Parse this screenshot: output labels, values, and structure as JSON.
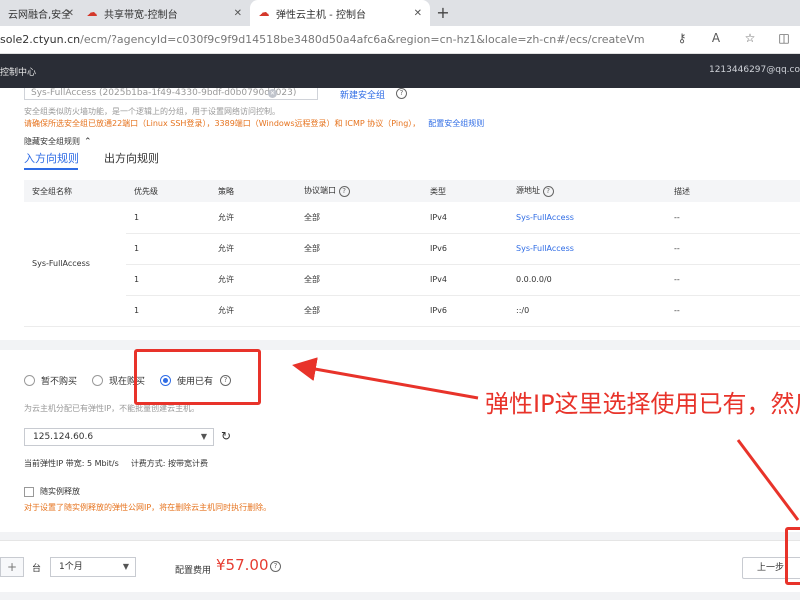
{
  "browser": {
    "tabs": [
      {
        "label": "云网融合,安全",
        "icon": "cloud-icon"
      },
      {
        "label": "共享带宽-控制台",
        "icon": "cloud-icon"
      },
      {
        "label": "弹性云主机 - 控制台",
        "icon": "cloud-icon",
        "active": true
      }
    ],
    "new_tab": "+",
    "url_host": "sole2.ctyun.cn",
    "url_path": "/ecm/?agencyId=c030f9c9f9d14518be3480d50a4afc6a&region=cn-hz1&locale=zh-cn#/ecs/createVm"
  },
  "console": {
    "title": "控制中心",
    "user": "1213446297@qq.co"
  },
  "security_group": {
    "select_value": "Sys-FullAccess (2025b1ba-1f49-4330-9bdf-d0b0790dd023)",
    "create_link": "新建安全组",
    "description": "安全组类似防火墙功能，是一个逻辑上的分组，用于设置网络访问控制。",
    "warning": "请确保所选安全组已放通22端口（Linux SSH登录），3389端口（Windows远程登录）和 ICMP 协议（Ping），",
    "config_link": "配置安全组规则",
    "toggle_label": "隐藏安全组规则",
    "tabs": [
      "入方向规则",
      "出方向规则"
    ],
    "columns": [
      "安全组名称",
      "优先级",
      "策略",
      "协议端口",
      "类型",
      "源地址",
      "描述"
    ],
    "group_name": "Sys-FullAccess",
    "rows": [
      {
        "priority": "1",
        "policy": "允许",
        "port": "全部",
        "type": "IPv4",
        "source": "Sys-FullAccess",
        "desc": "--"
      },
      {
        "priority": "1",
        "policy": "允许",
        "port": "全部",
        "type": "IPv6",
        "source": "Sys-FullAccess",
        "desc": "--"
      },
      {
        "priority": "1",
        "policy": "允许",
        "port": "全部",
        "type": "IPv4",
        "source": "0.0.0.0/0",
        "desc": "--"
      },
      {
        "priority": "1",
        "policy": "允许",
        "port": "全部",
        "type": "IPv6",
        "source": "::/0",
        "desc": "--"
      }
    ]
  },
  "eip": {
    "options": [
      "暂不购买",
      "现在购买",
      "使用已有"
    ],
    "description": "为云主机分配已有弹性IP，不能批量创建云主机。",
    "selected_ip": "125.124.60.6",
    "bandwidth": "当前弹性IP 带宽: 5 Mbit/s",
    "billing": "计费方式: 按带宽计费",
    "release_label": "随实例释放",
    "release_note": "对于设置了随实例释放的弹性公网IP，将在删除云主机同时执行删除。"
  },
  "footer": {
    "plus": "+",
    "unit": "台",
    "duration": "1个月",
    "fee_label": "配置费用",
    "fee_value": "¥57.00",
    "prev_button": "上一步"
  },
  "annotation": {
    "text": "弹性IP这里选择使用已有，然后"
  },
  "colors": {
    "accent": "#2f6ce5",
    "warning": "#e6731e",
    "price": "#e63c31",
    "annotation": "#e8332a",
    "header": "#2a2d36"
  }
}
